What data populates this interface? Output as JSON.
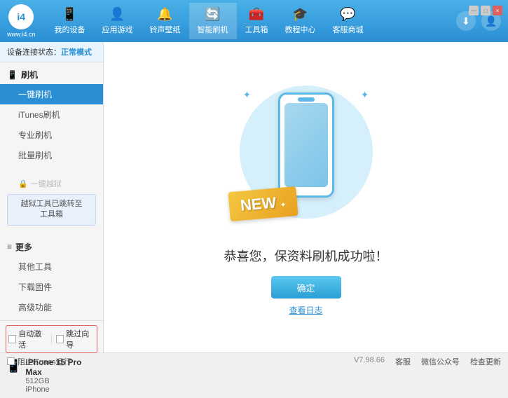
{
  "app": {
    "logo_text": "www.i4.cn",
    "logo_abbr": "i4"
  },
  "nav": {
    "items": [
      {
        "id": "my-device",
        "label": "我的设备",
        "icon": "📱"
      },
      {
        "id": "app-games",
        "label": "应用游戏",
        "icon": "👤"
      },
      {
        "id": "ringtone",
        "label": "铃声壁纸",
        "icon": "🔔"
      },
      {
        "id": "smart-flash",
        "label": "智能刷机",
        "icon": "🔄",
        "active": true
      },
      {
        "id": "tools",
        "label": "工具箱",
        "icon": "🧰"
      },
      {
        "id": "tutorial",
        "label": "教程中心",
        "icon": "🎓"
      },
      {
        "id": "service",
        "label": "客服商城",
        "icon": "💬"
      }
    ],
    "download_icon": "⬇",
    "user_icon": "👤"
  },
  "sidebar": {
    "status_label": "设备连接状态：",
    "status_value": "正常模式",
    "section_flash": {
      "header": "刷机",
      "header_icon": "📱",
      "items": [
        {
          "id": "one-click-flash",
          "label": "一键刷机",
          "active": true
        },
        {
          "id": "itunes-flash",
          "label": "iTunes刷机"
        },
        {
          "id": "pro-flash",
          "label": "专业刷机"
        },
        {
          "id": "batch-flash",
          "label": "批量刷机"
        }
      ]
    },
    "section_jailbreak": {
      "header": "一键越狱",
      "header_icon": "🔒",
      "disabled": true,
      "note_line1": "越狱工具已跳转至",
      "note_line2": "工具箱"
    },
    "section_more": {
      "header": "更多",
      "header_icon": "≡",
      "items": [
        {
          "id": "other-tools",
          "label": "其他工具"
        },
        {
          "id": "download-firmware",
          "label": "下载固件"
        },
        {
          "id": "advanced",
          "label": "高级功能"
        }
      ]
    }
  },
  "device": {
    "auto_activate_label": "自动激活",
    "guide_label": "跳过向导",
    "name": "iPhone 15 Pro Max",
    "storage": "512GB",
    "type": "iPhone",
    "icon": "📱"
  },
  "bottom_bar": {
    "itunes_label": "阻止iTunes运行",
    "version": "V7.98.66",
    "feedback_label": "客服",
    "wechat_label": "微信公众号",
    "check_update_label": "检查更新"
  },
  "content": {
    "success_text": "恭喜您，保资料刷机成功啦！",
    "confirm_btn": "确定",
    "log_link": "查看日志",
    "new_badge": "NEW"
  },
  "sparkles": [
    "✦",
    "✦"
  ]
}
